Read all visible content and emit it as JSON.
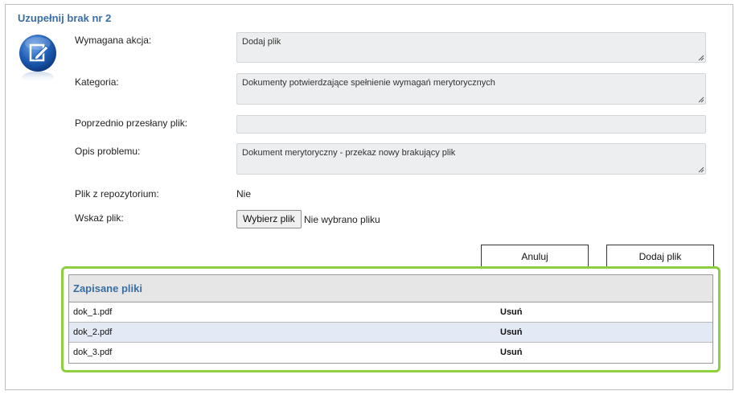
{
  "section": {
    "title": "Uzupełnij brak nr 2"
  },
  "form": {
    "required_action": {
      "label": "Wymagana akcja:",
      "value": "Dodaj plik"
    },
    "category": {
      "label": "Kategoria:",
      "value": "Dokumenty potwierdzające spełnienie wymagań merytorycznych"
    },
    "previous_file": {
      "label": "Poprzednio przesłany plik:",
      "value": ""
    },
    "problem_description": {
      "label": "Opis problemu:",
      "value": "Dokument merytoryczny - przekaz nowy brakujący plik"
    },
    "repository_file": {
      "label": "Plik z repozytorium:",
      "value": "Nie"
    },
    "choose_file": {
      "label": "Wskaż plik:",
      "button": "Wybierz plik",
      "status": "Nie wybrano pliku"
    }
  },
  "actions": {
    "cancel": "Anuluj",
    "add_file": "Dodaj plik"
  },
  "saved_files": {
    "title": "Zapisane pliki",
    "rows": [
      {
        "name": "dok_1.pdf",
        "action": "Usuń"
      },
      {
        "name": "dok_2.pdf",
        "action": "Usuń"
      },
      {
        "name": "dok_3.pdf",
        "action": "Usuń"
      }
    ]
  },
  "colors": {
    "accent": "#3a6ea5",
    "highlight": "#8ccf3f",
    "row_alt": "#e4e9f6"
  },
  "icons": {
    "section_icon": "edit-icon",
    "resize": "resize-grip-icon"
  }
}
